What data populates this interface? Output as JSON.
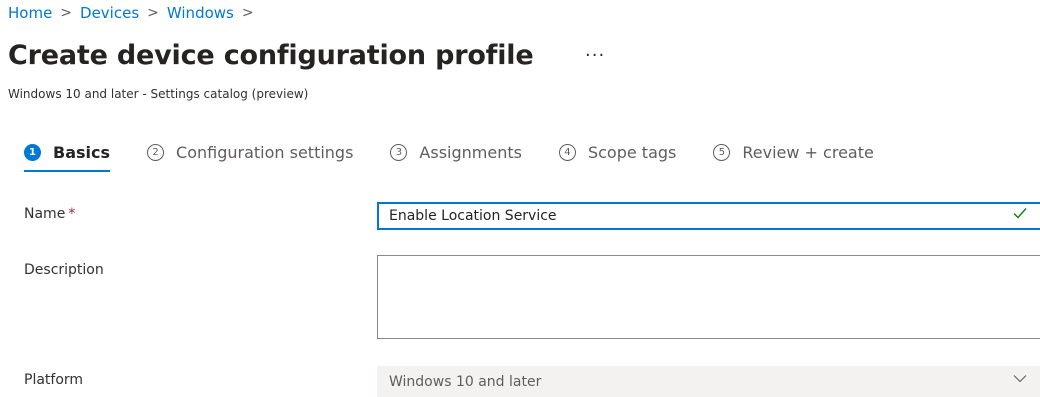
{
  "breadcrumb": {
    "items": [
      "Home",
      "Devices",
      "Windows"
    ],
    "separator": ">"
  },
  "header": {
    "title": "Create device configuration profile",
    "more_label": "···",
    "subtitle": "Windows 10 and later - Settings catalog (preview)"
  },
  "wizard": {
    "steps": [
      {
        "number": "1",
        "label": "Basics",
        "active": true
      },
      {
        "number": "2",
        "label": "Configuration settings",
        "active": false
      },
      {
        "number": "3",
        "label": "Assignments",
        "active": false
      },
      {
        "number": "4",
        "label": "Scope tags",
        "active": false
      },
      {
        "number": "5",
        "label": "Review + create",
        "active": false
      }
    ]
  },
  "form": {
    "name_label": "Name",
    "required_marker": "*",
    "name_value": "Enable Location Service",
    "valid_icon": "checkmark-icon",
    "description_label": "Description",
    "description_value": "",
    "platform_label": "Platform",
    "platform_value": "Windows 10 and later",
    "platform_dropdown_icon": "chevron-down-icon"
  },
  "colors": {
    "accent": "#0078d4",
    "required": "#a4262c",
    "valid": "#107c10",
    "disabled_bg": "#f3f2f1"
  }
}
